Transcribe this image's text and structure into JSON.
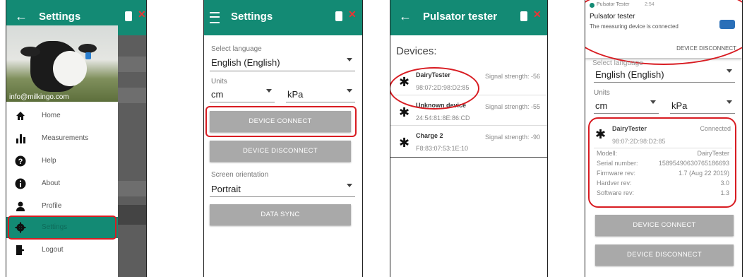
{
  "screen1": {
    "title": "Settings",
    "email": "info@milkingo.com",
    "menu": [
      {
        "label": "Home",
        "icon": "home-icon"
      },
      {
        "label": "Measurements",
        "icon": "bar-chart-icon"
      },
      {
        "label": "Help",
        "icon": "help-icon"
      },
      {
        "label": "About",
        "icon": "info-icon"
      },
      {
        "label": "Profile",
        "icon": "person-icon"
      },
      {
        "label": "Settings",
        "icon": "gear-icon"
      },
      {
        "label": "Logout",
        "icon": "logout-icon"
      }
    ]
  },
  "screen2": {
    "title": "Settings",
    "language_label": "Select language",
    "language_value": "English (English)",
    "units_label": "Units",
    "unit_length": "cm",
    "unit_pressure": "kPa",
    "connect_label": "DEVICE CONNECT",
    "disconnect_label": "DEVICE DISCONNECT",
    "orientation_label": "Screen orientation",
    "orientation_value": "Portrait",
    "sync_label": "DATA SYNC"
  },
  "screen3": {
    "title": "Pulsator tester",
    "devices_heading": "Devices:",
    "devices": [
      {
        "name": "DairyTester",
        "mac": "98:07:2D:98:D2:85",
        "signal": "Signal strength: -56"
      },
      {
        "name": "Unknown device",
        "mac": "24:54:81:8E:86:CD",
        "signal": "Signal strength: -55"
      },
      {
        "name": "Charge 2",
        "mac": "F8:83:07:53:1E:10",
        "signal": "Signal strength: -90"
      }
    ]
  },
  "screen4": {
    "notif_app": "Pulsator Tester",
    "notif_time": "2:54",
    "notif_title": "Pulsator tester",
    "notif_text": "The measuring device is connected",
    "notif_action": "DEVICE DISCONNECT",
    "language_partial": "Select language",
    "language_value": "English (English)",
    "units_label": "Units",
    "unit_length": "cm",
    "unit_pressure": "kPa",
    "device_name": "DairyTester",
    "device_status": "Connected",
    "device_mac": "98:07:2D:98:D2:85",
    "details": [
      {
        "key": "Modell:",
        "value": "DairyTester"
      },
      {
        "key": "Serial number:",
        "value": "15895490630765186693"
      },
      {
        "key": "Firmware rev:",
        "value": "1.7 (Aug 22 2019)"
      },
      {
        "key": "Hardver rev:",
        "value": "3.0"
      },
      {
        "key": "Software rev:",
        "value": "1.3"
      }
    ],
    "connect_label": "DEVICE CONNECT",
    "disconnect_label": "DEVICE DISCONNECT"
  },
  "colors": {
    "appbar": "#138a74",
    "highlight": "#d81c22",
    "button": "#a9a9a9"
  }
}
